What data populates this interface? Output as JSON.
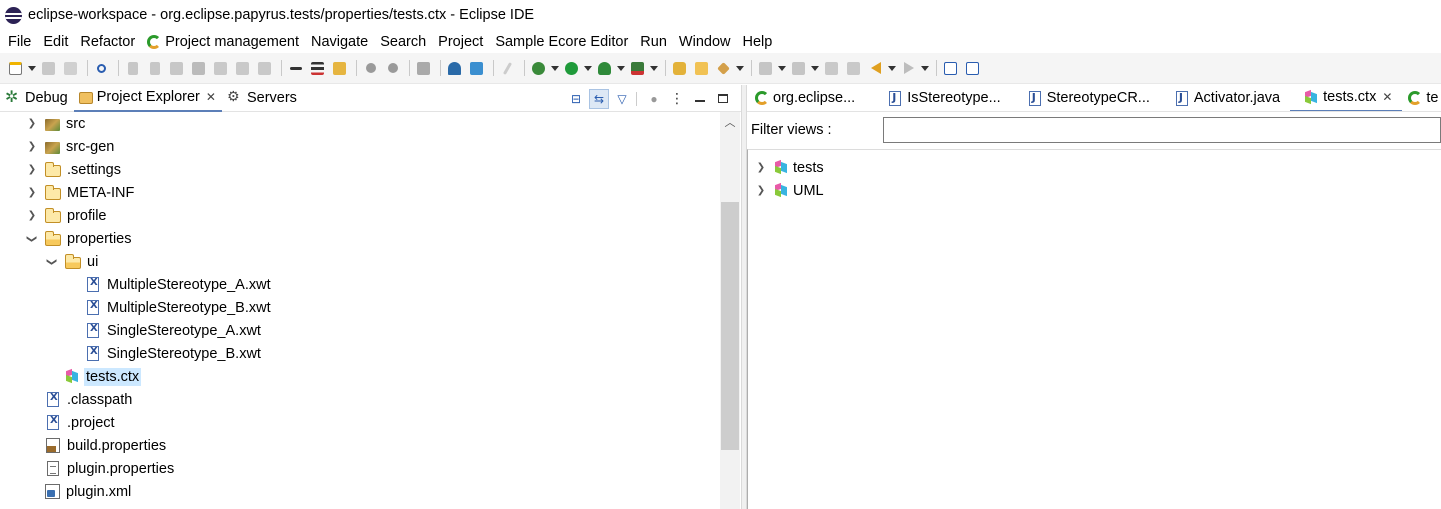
{
  "window": {
    "title": "eclipse-workspace - org.eclipse.papyrus.tests/properties/tests.ctx - Eclipse IDE"
  },
  "menu": {
    "items": [
      "File",
      "Edit",
      "Refactor",
      "Project management",
      "Navigate",
      "Search",
      "Project",
      "Sample Ecore Editor",
      "Run",
      "Window",
      "Help"
    ]
  },
  "left_panel": {
    "tabs": [
      {
        "label": "Debug",
        "icon": "bug-icon",
        "active": false
      },
      {
        "label": "Project Explorer",
        "icon": "folder-icon",
        "active": true,
        "closable": true
      },
      {
        "label": "Servers",
        "icon": "servers-icon",
        "active": false
      }
    ],
    "tree": [
      {
        "label": "src",
        "icon": "source-package-icon",
        "expanded": false,
        "has_children": true
      },
      {
        "label": "src-gen",
        "icon": "source-package-icon",
        "expanded": false,
        "has_children": true
      },
      {
        "label": ".settings",
        "icon": "folder-icon",
        "expanded": false,
        "has_children": true
      },
      {
        "label": "META-INF",
        "icon": "folder-icon",
        "expanded": false,
        "has_children": true
      },
      {
        "label": "profile",
        "icon": "folder-icon",
        "expanded": false,
        "has_children": true
      },
      {
        "label": "properties",
        "icon": "folder-open-icon",
        "expanded": true,
        "has_children": true
      },
      {
        "label": "ui",
        "icon": "folder-open-icon",
        "expanded": true,
        "has_children": true
      },
      {
        "label": "MultipleStereotype_A.xwt",
        "icon": "xml-file-icon",
        "has_children": false
      },
      {
        "label": "MultipleStereotype_B.xwt",
        "icon": "xml-file-icon",
        "has_children": false
      },
      {
        "label": "SingleStereotype_A.xwt",
        "icon": "xml-file-icon",
        "has_children": false
      },
      {
        "label": "SingleStereotype_B.xwt",
        "icon": "xml-file-icon",
        "has_children": false
      },
      {
        "label": "tests.ctx",
        "icon": "context-cube-icon",
        "has_children": false,
        "selected": true
      },
      {
        "label": ".classpath",
        "icon": "xml-file-icon",
        "has_children": false
      },
      {
        "label": ".project",
        "icon": "xml-file-icon",
        "has_children": false
      },
      {
        "label": "build.properties",
        "icon": "build-properties-icon",
        "has_children": false
      },
      {
        "label": "plugin.properties",
        "icon": "text-file-icon",
        "has_children": false
      },
      {
        "label": "plugin.xml",
        "icon": "plugin-file-icon",
        "has_children": false
      }
    ]
  },
  "editor": {
    "tabs": [
      {
        "label": "org.eclipse...",
        "icon": "plugin-manifest-icon",
        "active": false
      },
      {
        "label": "IsStereotype...",
        "icon": "java-file-icon",
        "active": false
      },
      {
        "label": "StereotypeCR...",
        "icon": "java-file-icon",
        "active": false
      },
      {
        "label": "Activator.java",
        "icon": "java-file-icon",
        "active": false
      },
      {
        "label": "tests.ctx",
        "icon": "context-cube-icon",
        "active": true,
        "closable": true
      },
      {
        "label": "te",
        "icon": "plugin-manifest-icon",
        "active": false
      }
    ],
    "filter": {
      "label": "Filter views :",
      "value": "",
      "placeholder": ""
    },
    "tree": [
      {
        "label": "tests",
        "icon": "context-cube-icon",
        "expanded": false
      },
      {
        "label": "UML",
        "icon": "context-cube-icon",
        "expanded": false
      }
    ]
  }
}
